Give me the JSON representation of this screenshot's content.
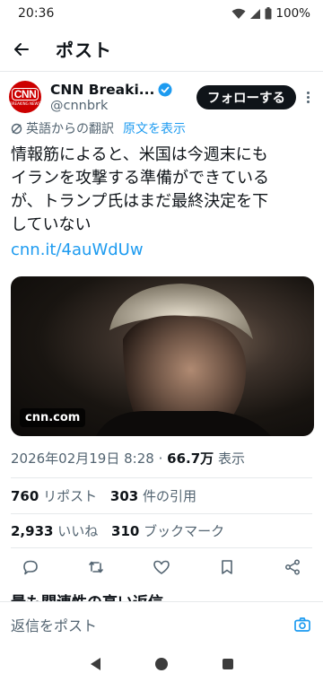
{
  "status_bar": {
    "time": "20:36",
    "battery": "100%"
  },
  "header": {
    "title": "ポスト"
  },
  "author": {
    "display_name": "CNN Breaki...",
    "handle": "@cnnbrk",
    "avatar_text": "CNN",
    "avatar_subtext": "BREAKING NEWS",
    "follow_label": "フォローする"
  },
  "translation": {
    "label": "英語からの翻訳",
    "show_original": "原文を表示"
  },
  "tweet": {
    "lines": [
      "情報筋によると、米国は今週末にも",
      "イランを攻撃する準備ができている",
      "が、トランプ氏はまだ最終決定を下",
      "していない"
    ],
    "link": "cnn.it/4auWdUw",
    "media_source": "cnn.com"
  },
  "meta": {
    "datetime": "2026年02月19日 8:28",
    "separator": "·",
    "views_count": "66.7万",
    "views_label": "表示"
  },
  "stats": {
    "reposts_count": "760",
    "reposts_label": "リポスト",
    "quotes_count": "303",
    "quotes_label": "件の引用",
    "likes_count": "2,933",
    "likes_label": "いいね",
    "bookmarks_count": "310",
    "bookmarks_label": "ブックマーク"
  },
  "replies_header": "最も関連性の高い返信",
  "reply_bar": {
    "placeholder": "返信をポスト"
  },
  "colors": {
    "accent": "#1d9bf0",
    "text": "#0f1419",
    "secondary": "#536471",
    "cnn_red": "#cc0000"
  }
}
